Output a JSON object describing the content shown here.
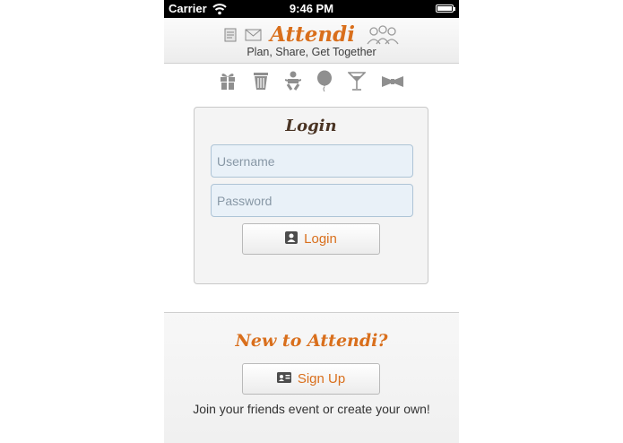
{
  "status_bar": {
    "carrier": "Carrier",
    "time": "9:46 PM"
  },
  "header": {
    "brand": "Attendi",
    "tagline": "Plan, Share, Get Together"
  },
  "event_icons": [
    "gift-icon",
    "trash-can-icon",
    "baby-icon",
    "balloon-icon",
    "cocktail-icon",
    "bow-tie-icon"
  ],
  "login": {
    "title": "Login",
    "username_placeholder": "Username",
    "password_placeholder": "Password",
    "button_label": "Login"
  },
  "signup": {
    "title": "New to Attendi?",
    "button_label": "Sign Up",
    "description": "Join your friends event or create your own!"
  },
  "colors": {
    "accent": "#d96f1c",
    "title_dark": "#4a3424",
    "icon_gray": "#8f8f8f"
  }
}
